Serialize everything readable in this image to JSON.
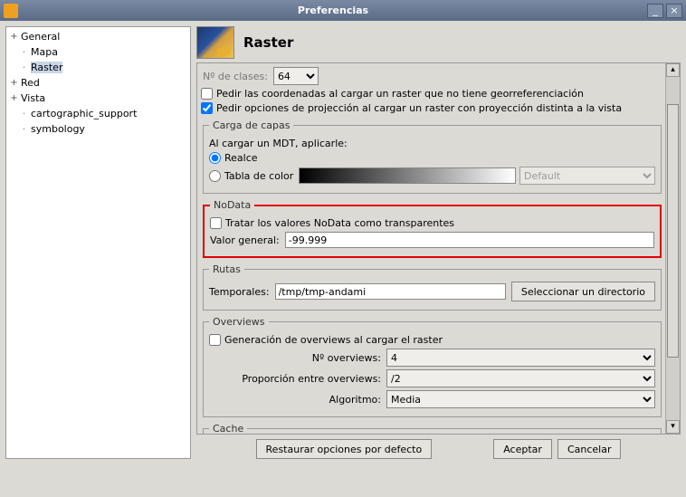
{
  "window": {
    "title": "Preferencias"
  },
  "tree": {
    "items": [
      {
        "label": "General",
        "expander": "+"
      },
      {
        "label": "Mapa"
      },
      {
        "label": "Raster",
        "selected": true
      },
      {
        "label": "Red",
        "expander": "+"
      },
      {
        "label": "Vista",
        "expander": "+"
      },
      {
        "label": "cartographic_support"
      },
      {
        "label": "symbology"
      }
    ]
  },
  "header": {
    "title": "Raster"
  },
  "top": {
    "classes_label": "Nº de clases:",
    "classes_value": "64",
    "ask_coords": "Pedir las coordenadas al cargar un raster que no tiene georreferenciación",
    "ask_proj": "Pedir opciones de projección al cargar un raster con proyección distinta a la vista"
  },
  "carga": {
    "legend": "Carga de capas",
    "mdt_label": "Al cargar un MDT, aplicarle:",
    "realce": "Realce",
    "tabla": "Tabla de color",
    "default_option": "Default"
  },
  "nodata": {
    "legend": "NoData",
    "transparent": "Tratar los valores NoData como transparentes",
    "valor_label": "Valor general:",
    "valor_value": "-99.999"
  },
  "rutas": {
    "legend": "Rutas",
    "temporales_label": "Temporales:",
    "temporales_value": "/tmp/tmp-andami",
    "select_dir": "Seleccionar un directorio"
  },
  "overviews": {
    "legend": "Overviews",
    "generate": "Generación de overviews al cargar el raster",
    "n_label": "Nº overviews:",
    "n_value": "4",
    "prop_label": "Proporción entre overviews:",
    "prop_value": "/2",
    "algo_label": "Algoritmo:",
    "algo_value": "Media"
  },
  "cache": {
    "legend": "Cache"
  },
  "buttons": {
    "restore": "Restaurar opciones por defecto",
    "accept": "Aceptar",
    "cancel": "Cancelar"
  }
}
